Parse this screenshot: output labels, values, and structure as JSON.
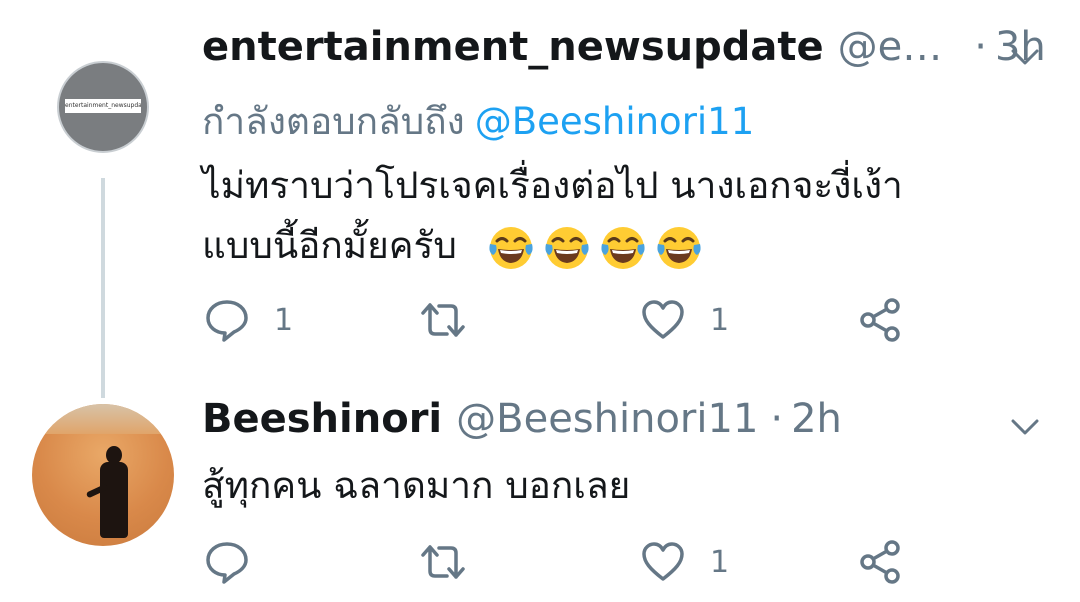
{
  "tweets": [
    {
      "display_name": "entertainment_newsupdate",
      "handle": "@e…",
      "separator": "·",
      "time": "3h",
      "avatar_text": "entertainment_newsupdate",
      "replying_prefix": "กำลังตอบกลับถึง",
      "replying_to": "@Beeshinori11",
      "text_line1": "ไม่ทราบว่าโปรเจคเรื่องต่อไป นางเอกจะงี่เง้า",
      "text_line2": "แบบนี้อีกมั้ยครับ",
      "emoji": "face-with-tears-of-joy",
      "emoji_count": 4,
      "reply_count": "1",
      "retweet_count": "",
      "like_count": "1"
    },
    {
      "display_name": "Beeshinori",
      "handle": "@Beeshinori11",
      "separator": "·",
      "time": "2h",
      "text_line1": "สู้ทุกคน ฉลาดมาก บอกเลย",
      "reply_count": "",
      "retweet_count": "",
      "like_count": "1"
    }
  ],
  "colors": {
    "text": "#14171a",
    "secondary": "#657786",
    "link": "#1da1f2",
    "thread_line": "#cfd9de"
  }
}
